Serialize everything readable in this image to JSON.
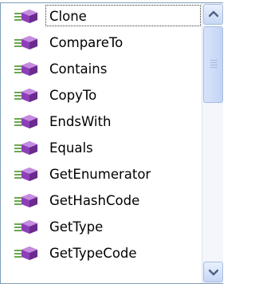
{
  "members": [
    {
      "label": "Clone",
      "icon": "method-icon",
      "selected": true
    },
    {
      "label": "CompareTo",
      "icon": "method-icon"
    },
    {
      "label": "Contains",
      "icon": "method-icon"
    },
    {
      "label": "CopyTo",
      "icon": "method-icon"
    },
    {
      "label": "EndsWith",
      "icon": "method-icon"
    },
    {
      "label": "Equals",
      "icon": "method-icon"
    },
    {
      "label": "GetEnumerator",
      "icon": "method-icon"
    },
    {
      "label": "GetHashCode",
      "icon": "method-icon"
    },
    {
      "label": "GetType",
      "icon": "method-icon"
    },
    {
      "label": "GetTypeCode",
      "icon": "method-icon"
    }
  ],
  "scrollbar": {
    "up_icon": "chevron-up-icon",
    "down_icon": "chevron-down-icon"
  },
  "colors": {
    "method_icon_purple": "#8d3fb8",
    "method_icon_lines": "#6aa84f",
    "border": "#7f9db9",
    "scroll_arrow": "#4d6185"
  }
}
